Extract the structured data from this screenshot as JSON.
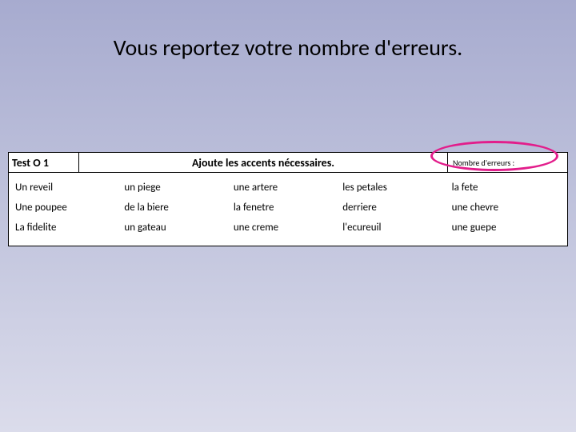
{
  "title": "Vous reportez votre nombre d'erreurs.",
  "header": {
    "test_label": "Test O 1",
    "instruction": "Ajoute les accents nécessaires.",
    "errors_label": "Nombre d'erreurs :"
  },
  "rows": [
    {
      "c0": "Un reveil",
      "c1": "un piege",
      "c2": "une artere",
      "c3": "les petales",
      "c4": "la fete"
    },
    {
      "c0": "Une poupee",
      "c1": "de la biere",
      "c2": "la fenetre",
      "c3": "derriere",
      "c4": "une chevre"
    },
    {
      "c0": "La fidelite",
      "c1": "un gateau",
      "c2": "une creme",
      "c3": "l'ecureuil",
      "c4": "une guepe"
    }
  ]
}
